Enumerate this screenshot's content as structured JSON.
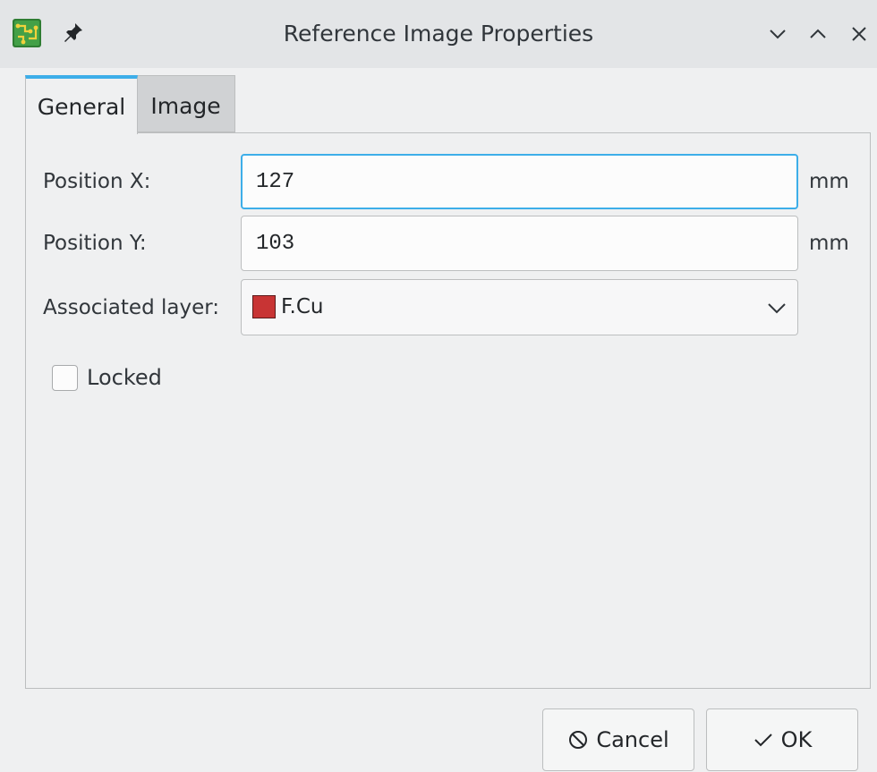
{
  "window": {
    "title": "Reference Image Properties"
  },
  "titlebar_buttons": {
    "minimize_icon": "chevron-down-icon",
    "maximize_icon": "chevron-up-icon",
    "close_icon": "close-icon"
  },
  "tabs": [
    {
      "label": "General",
      "active": true
    },
    {
      "label": "Image",
      "active": false
    }
  ],
  "general": {
    "position_x": {
      "label": "Position X:",
      "value": "127",
      "unit": "mm"
    },
    "position_y": {
      "label": "Position Y:",
      "value": "103",
      "unit": "mm"
    },
    "layer": {
      "label": "Associated layer:",
      "value": "F.Cu",
      "color": "#c83434"
    },
    "locked": {
      "label": "Locked",
      "checked": false
    }
  },
  "buttons": {
    "cancel": "Cancel",
    "ok": "OK"
  },
  "colors": {
    "accent": "#3daee9",
    "background": "#eff0f1"
  }
}
